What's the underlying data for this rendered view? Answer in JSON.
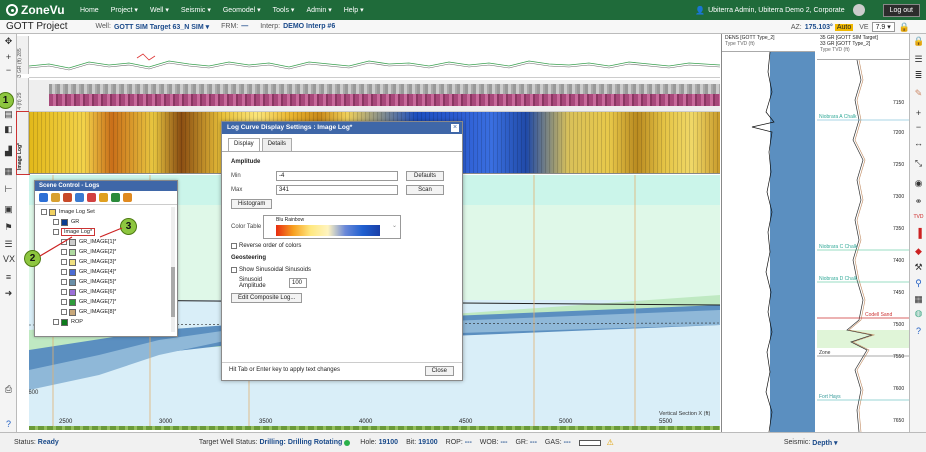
{
  "nav": {
    "brand": "ZoneVu",
    "items": [
      "Home",
      "Project ▾",
      "Well ▾",
      "Seismic ▾",
      "Geomodel ▾",
      "Tools ▾",
      "Admin ▾",
      "Help ▾"
    ],
    "user": "Ubiterra Admin, Ubiterra Demo 2, Corporate",
    "logout": "Log out"
  },
  "subheader": {
    "project": "GOTT Project",
    "well_label": "Well:",
    "well": "GOTT SIM Target 63_N SIM ▾",
    "frm_label": "FRM:",
    "frm": "—",
    "interp_label": "Interp:",
    "interp": "DEMO Interp #6",
    "az_label": "AZ:",
    "az": "175.103°",
    "auto": "Auto",
    "ve_label": "VE",
    "ve": "7.9 ▾"
  },
  "track_labels": [
    "33 GR (ft) 285",
    "2 3 4 (ft) 29",
    "Image Log*"
  ],
  "dialog": {
    "title": "Log Curve Display Settings : Image Log*",
    "tabs": [
      "Display",
      "Details"
    ],
    "amplitude_heading": "Amplitude",
    "min_label": "Min",
    "min_value": "-4",
    "max_label": "Max",
    "max_value": "341",
    "defaults_btn": "Defaults",
    "scan_btn": "Scan",
    "histogram_btn": "Histogram",
    "color_table_label": "Color Table",
    "color_table_value": "Blu Rainbow",
    "reverse_label": "Reverse order of colors",
    "geosteering_heading": "Geosteering",
    "show_sinusoids_label": "Show Sinusoidal Sinusoids",
    "sinusoid_label": "Sinusoid Amplitude",
    "sinusoid_value": "100",
    "edit_btn": "Edit Composite Log...",
    "footer_hint": "Hit Tab or Enter key to apply text changes",
    "close_btn": "Close"
  },
  "scene_control": {
    "title": "Scene Control - Logs",
    "items": [
      {
        "label": "Image Log Set",
        "color": ""
      },
      {
        "label": "GR",
        "color": "#0b3d91"
      },
      {
        "label": "Image Log*",
        "color": ""
      },
      {
        "label": "GR_IMAGE[1]*",
        "color": "#ccc"
      },
      {
        "label": "GR_IMAGE[2]*",
        "color": "#aed9a0"
      },
      {
        "label": "GR_IMAGE[3]*",
        "color": "#f0e080"
      },
      {
        "label": "GR_IMAGE[4]*",
        "color": "#4b6cd4"
      },
      {
        "label": "GR_IMAGE[5]*",
        "color": "#6a8fa8"
      },
      {
        "label": "GR_IMAGE[6]*",
        "color": "#9b6ed8"
      },
      {
        "label": "GR_IMAGE[7]*",
        "color": "#2f9c3c"
      },
      {
        "label": "GR_IMAGE[8]*",
        "color": "#c8a87a"
      },
      {
        "label": "ROP",
        "color": "#0d7a1c"
      }
    ]
  },
  "badges": [
    "1",
    "2",
    "3"
  ],
  "x_ticks": [
    "2500",
    "3000",
    "3500",
    "4000",
    "4500",
    "5000",
    "5500"
  ],
  "y_tick": "7600",
  "section_label": "Vertical Section X (ft)",
  "log_panel": {
    "col1_title": "DENS [GOTT Type_2]",
    "col1_sub": "Type TVD (ft)",
    "col2_title": "35 GR [GOTT SIM Target]",
    "col2_title2": "33 GR [GOTT Type_2]",
    "col2_sub": "Type TVD (ft)",
    "depths": [
      "7150",
      "7200",
      "7250",
      "7300",
      "7350",
      "7400",
      "7450",
      "7500",
      "7550",
      "7600",
      "7650"
    ],
    "markers": [
      "Niobrara A Chalk",
      "Niobrara C Chalk",
      "Niobrara D Chalk",
      "Fort Hays",
      "Codell Sand",
      "Zone"
    ]
  },
  "status": {
    "status_label": "Status:",
    "status": "Ready",
    "target_label": "Target Well Status:",
    "target": "Drilling: Drilling Rotating",
    "hole_label": "Hole:",
    "hole": "19100",
    "bit_label": "Bit:",
    "bit": "19100",
    "rop_label": "ROP:",
    "rop": "---",
    "wob_label": "WOB:",
    "wob": "---",
    "gr_label": "GR:",
    "gr": "---",
    "gas_label": "GAS:",
    "gas": "---",
    "seismic_label": "Seismic:",
    "seismic": "Depth ▾"
  }
}
